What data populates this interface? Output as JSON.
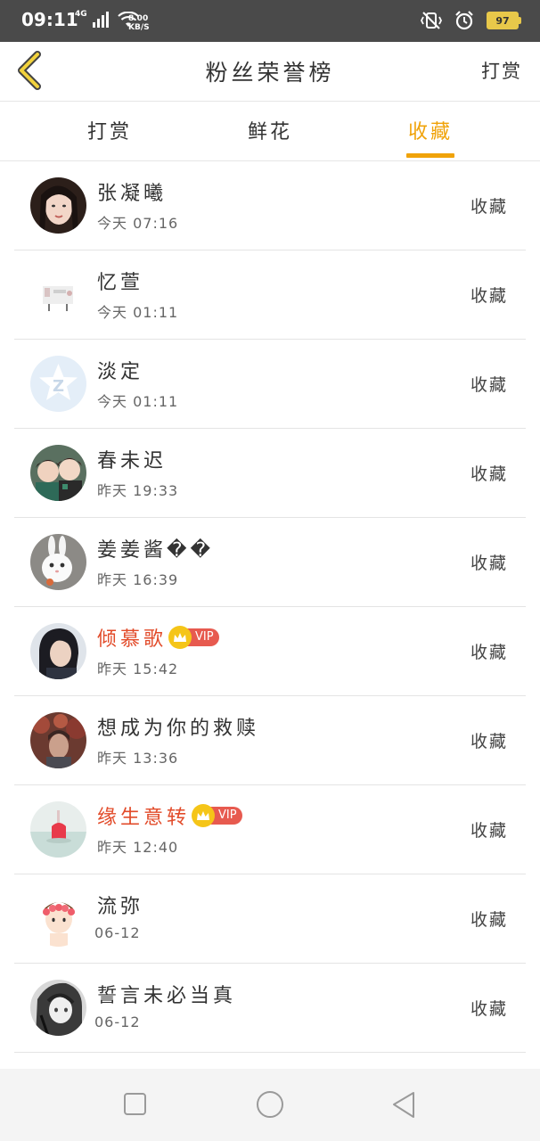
{
  "status_bar": {
    "time": "09:11",
    "network": "4G",
    "speed_value": "8.00",
    "speed_unit": "KB/S",
    "battery": "97"
  },
  "header": {
    "title": "粉丝荣誉榜",
    "action": "打赏"
  },
  "tabs": [
    {
      "label": "打赏",
      "active": false
    },
    {
      "label": "鲜花",
      "active": false
    },
    {
      "label": "收藏",
      "active": true
    }
  ],
  "fans": [
    {
      "name": "张凝曦",
      "time": "今天 07:16",
      "action": "收藏",
      "vip": false
    },
    {
      "name": "忆萱",
      "time": "今天 01:11",
      "action": "收藏",
      "vip": false
    },
    {
      "name": "淡定",
      "time": "今天 01:11",
      "action": "收藏",
      "vip": false
    },
    {
      "name": "春未迟",
      "time": "昨天 19:33",
      "action": "收藏",
      "vip": false
    },
    {
      "name": "姜姜酱��",
      "time": "昨天 16:39",
      "action": "收藏",
      "vip": false
    },
    {
      "name": "倾慕歌",
      "time": "昨天 15:42",
      "action": "收藏",
      "vip": true,
      "badge": "VIP"
    },
    {
      "name": "想成为你的救赎",
      "time": "昨天 13:36",
      "action": "收藏",
      "vip": false
    },
    {
      "name": "缘生意转",
      "time": "昨天 12:40",
      "action": "收藏",
      "vip": true,
      "badge": "VIP"
    },
    {
      "name": "流弥",
      "time": "06-12",
      "action": "收藏",
      "vip": false
    },
    {
      "name": "誓言未必当真",
      "time": "06-12",
      "action": "收藏",
      "vip": false
    }
  ],
  "colors": {
    "accent": "#f0a30a",
    "vip_name": "#e24b2a",
    "vip_badge": "#e75a4f",
    "status_bar": "#4a4a4a"
  }
}
